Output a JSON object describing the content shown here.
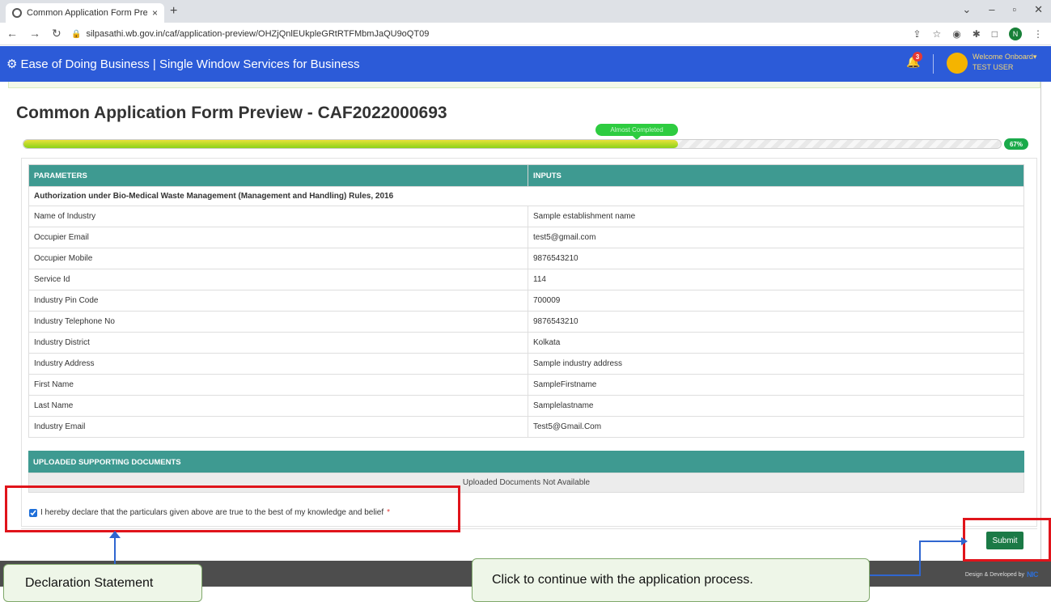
{
  "browser": {
    "tab_title": "Common Application Form Prev",
    "tab_close": "×",
    "new_tab": "+",
    "url": "silpasathi.wb.gov.in/caf/application-preview/OHZjQnlEUkpleGRtRTFMbmJaQU9oQT09",
    "profile_initial": "N"
  },
  "header": {
    "brand": "Ease of Doing Business | Single Window Services for Business",
    "notification_count": "3",
    "welcome": "Welcome Onboard",
    "user_name": "TEST USER"
  },
  "page": {
    "title": "Common Application Form Preview - CAF2022000693",
    "progress_percent": 67,
    "progress_label": "67%",
    "progress_tip": "Almost Completed"
  },
  "table": {
    "headers": [
      "PARAMETERS",
      "INPUTS"
    ],
    "section": "Authorization under Bio-Medical Waste Management (Management and Handling) Rules, 2016",
    "rows": [
      {
        "param": "Name of Industry",
        "value": "Sample establishment name"
      },
      {
        "param": "Occupier Email",
        "value": "test5@gmail.com"
      },
      {
        "param": "Occupier Mobile",
        "value": "9876543210"
      },
      {
        "param": "Service Id",
        "value": "114"
      },
      {
        "param": "Industry Pin Code",
        "value": "700009"
      },
      {
        "param": "Industry Telephone No",
        "value": "9876543210"
      },
      {
        "param": "Industry District",
        "value": "Kolkata"
      },
      {
        "param": "Industry Address",
        "value": "Sample industry address"
      },
      {
        "param": "First Name",
        "value": "SampleFirstname"
      },
      {
        "param": "Last Name",
        "value": "Samplelastname"
      },
      {
        "param": "Industry Email",
        "value": "Test5@Gmail.Com"
      }
    ]
  },
  "documents": {
    "heading": "UPLOADED SUPPORTING DOCUMENTS",
    "empty_text": "Uploaded Documents Not Available"
  },
  "declaration": {
    "text": "I hereby declare that the particulars given above are true to the best of my knowledge and belief",
    "required_mark": "*",
    "checked": true
  },
  "actions": {
    "submit_label": "Submit"
  },
  "footer": {
    "credit": "Design & Developed by",
    "logo_text": "NIC"
  },
  "annotations": {
    "declaration_label": "Declaration Statement",
    "submit_label": "Click to continue with the application process."
  },
  "colors": {
    "header_blue": "#2c5bd8",
    "table_teal": "#3e9a91",
    "submit_green": "#1b7a46",
    "annotation_red": "#e0141b"
  }
}
